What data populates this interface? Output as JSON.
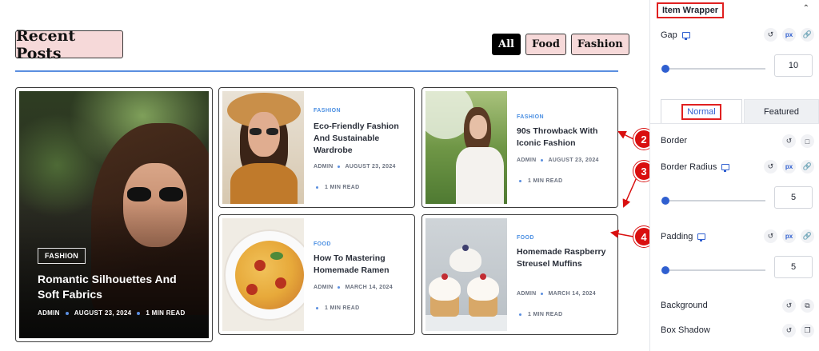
{
  "preview": {
    "title": "Recent Posts",
    "filters": [
      {
        "label": "All",
        "active": true
      },
      {
        "label": "Food",
        "active": false
      },
      {
        "label": "Fashion",
        "active": false
      }
    ],
    "featured_post": {
      "category": "FASHION",
      "title": "Romantic Silhouettes And Soft Fabrics",
      "author": "ADMIN",
      "date": "AUGUST 23, 2024",
      "read_time": "1 MIN READ"
    },
    "posts": [
      {
        "category": "FASHION",
        "title": "Eco-Friendly Fashion And Sustainable Wardrobe",
        "author": "ADMIN",
        "date": "AUGUST 23, 2024",
        "read_time": "1 MIN READ"
      },
      {
        "category": "FASHION",
        "title": "90s Throwback With Iconic Fashion",
        "author": "ADMIN",
        "date": "AUGUST 23, 2024",
        "read_time": "1 MIN READ"
      },
      {
        "category": "FOOD",
        "title": "How To Mastering Homemade Ramen",
        "author": "ADMIN",
        "date": "MARCH 14, 2024",
        "read_time": "1 MIN READ"
      },
      {
        "category": "FOOD",
        "title": "Homemade Raspberry Streusel Muffins",
        "author": "ADMIN",
        "date": "MARCH 14, 2024",
        "read_time": "1 MIN READ"
      }
    ]
  },
  "callouts": [
    "2",
    "3",
    "4"
  ],
  "panel": {
    "section_title": "Item Wrapper",
    "gap": {
      "label": "Gap",
      "unit": "px",
      "value": "10"
    },
    "tabs": {
      "normal": "Normal",
      "featured": "Featured"
    },
    "border": {
      "label": "Border"
    },
    "border_radius": {
      "label": "Border Radius",
      "unit": "px",
      "value": "5"
    },
    "padding": {
      "label": "Padding",
      "unit": "px",
      "value": "5"
    },
    "background": {
      "label": "Background"
    },
    "box_shadow": {
      "label": "Box Shadow"
    }
  },
  "colors": {
    "accent": "#2f5fd0",
    "category": "#4b8fe2",
    "callout": "#d90f0f",
    "title_bg": "#f6d9d9",
    "divider": "#5b8fe0"
  },
  "icons": [
    "monitor-icon",
    "reset-icon",
    "link-icon",
    "chevron-up-icon",
    "border-style-icon",
    "duplicate-icon",
    "shadow-icon"
  ]
}
